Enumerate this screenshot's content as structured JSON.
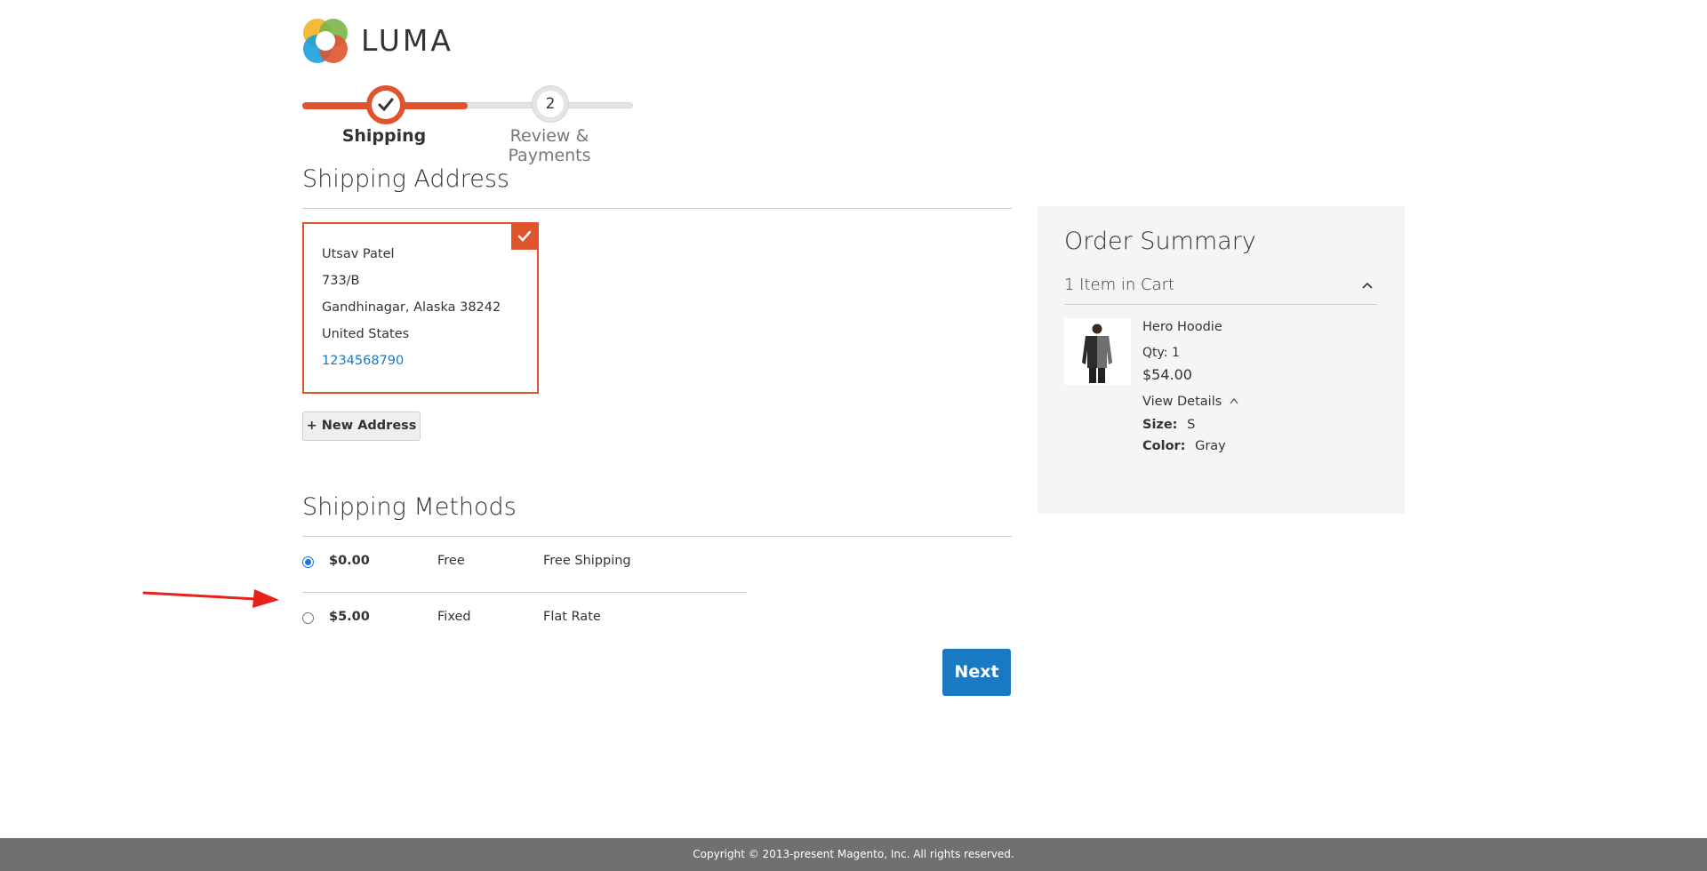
{
  "brand": {
    "name": "LUMA"
  },
  "progress": {
    "steps": [
      {
        "label": "Shipping",
        "state": "complete"
      },
      {
        "label": "Review & Payments",
        "number": "2",
        "state": "pending"
      }
    ],
    "accent_color": "#e0542d"
  },
  "shipping_address": {
    "heading": "Shipping Address",
    "selected_address": {
      "name": "Utsav Patel",
      "street": "733/B",
      "city_line": "Gandhinagar, Alaska 38242",
      "country": "United States",
      "phone": "1234568790"
    },
    "new_address_button": "+ New Address"
  },
  "shipping_methods": {
    "heading": "Shipping Methods",
    "options": [
      {
        "price": "$0.00",
        "method": "Free",
        "carrier": "Free Shipping",
        "selected": true
      },
      {
        "price": "$5.00",
        "method": "Fixed",
        "carrier": "Flat Rate",
        "selected": false
      }
    ],
    "next_button": "Next"
  },
  "order_summary": {
    "title": "Order Summary",
    "cart_count_label": "1 Item in Cart",
    "items": [
      {
        "name": "Hero Hoodie",
        "qty_label": "Qty: 1",
        "price": "$54.00",
        "view_details": "View Details",
        "options": [
          {
            "label": "Size:",
            "value": "S"
          },
          {
            "label": "Color:",
            "value": "Gray"
          }
        ]
      }
    ]
  },
  "footer": {
    "copyright": "Copyright © 2013-present Magento, Inc. All rights reserved."
  },
  "colors": {
    "primary_blue": "#1979c3",
    "footer_gray": "#6e716e",
    "annotation_arrow": "#e8201c"
  }
}
